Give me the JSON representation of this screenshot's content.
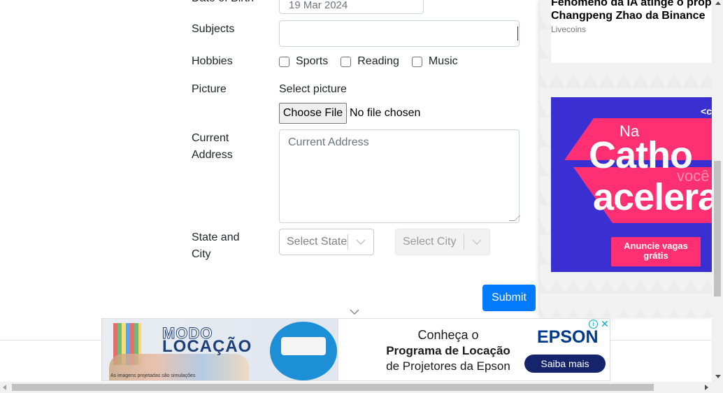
{
  "form": {
    "dob_label": "Date of Birth",
    "dob_value": "19 Mar 2024",
    "subjects_label": "Subjects",
    "hobbies_label": "Hobbies",
    "hobbies": [
      "Sports",
      "Reading",
      "Music"
    ],
    "picture_label": "Picture",
    "picture_sublabel": "Select picture",
    "file_button": "Choose File",
    "file_status": "No file chosen",
    "address_label_1": "Current",
    "address_label_2": "Address",
    "address_placeholder": "Current Address",
    "state_city_label_1": "State and",
    "state_city_label_2": "City",
    "state_placeholder": "Select State",
    "city_placeholder": "Select City",
    "submit": "Submit"
  },
  "sidebar": {
    "news_title_1": "Fenômeno da IA atinge o prop",
    "news_title_2": "Changpeng Zhao da Binance",
    "news_source": "Livecoins",
    "catho": {
      "na": "Na",
      "line1": "Catho",
      "voce": "você",
      "line2": "acelera",
      "cta": "Anuncie vagas grátis"
    }
  },
  "ad": {
    "brand_line1": "MODO",
    "brand_line2": "LOCAÇÃO",
    "fine_print": "As imagens projetadas são simulações",
    "text1": "Conheça o",
    "text2": "Programa de Locação",
    "text3": "de Projetores da Epson",
    "logo": "EPSON",
    "cta": "Saiba mais",
    "info": "i",
    "close": "✕"
  },
  "colors": {
    "primary": "#007bff",
    "catho_bg": "#3a2fd0",
    "catho_pink": "#ff2f73",
    "epson_blue": "#003a8c"
  }
}
